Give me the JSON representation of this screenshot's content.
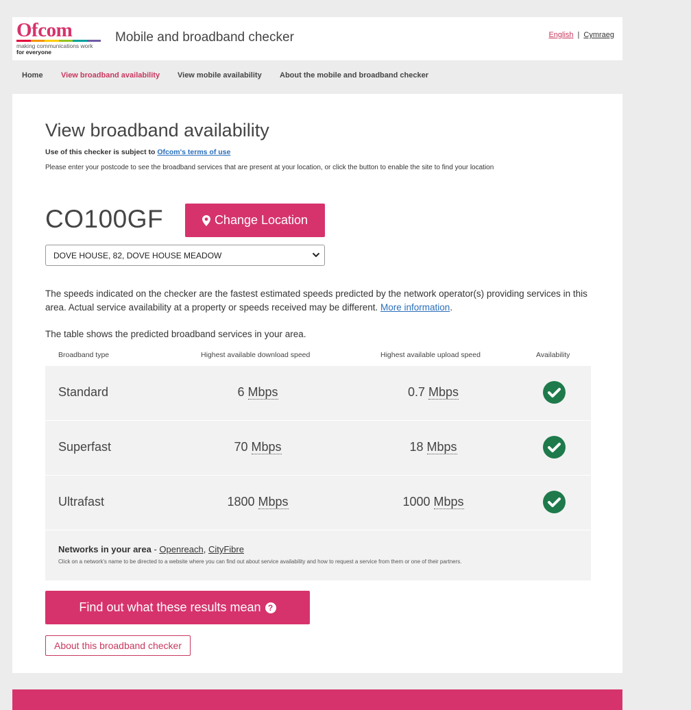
{
  "header": {
    "logo": {
      "wordmark": "Ofcom",
      "tagline": "making communications work",
      "tagline2": "for everyone",
      "stripe_colors": [
        "#e4003b",
        "#f39200",
        "#ffcc00",
        "#95c11f",
        "#00a19a",
        "#6e5ba6"
      ]
    },
    "app_title": "Mobile and broadband checker",
    "lang_english": "English",
    "lang_separator": "|",
    "lang_welsh": "Cymraeg"
  },
  "nav": {
    "items": [
      {
        "label": "Home",
        "active": false
      },
      {
        "label": "View broadband availability",
        "active": true
      },
      {
        "label": "View mobile availability",
        "active": false
      },
      {
        "label": "About the mobile and broadband checker",
        "active": false
      }
    ]
  },
  "main": {
    "title": "View broadband availability",
    "terms_prefix": "Use of this checker is subject to ",
    "terms_link": "Ofcom's terms of use",
    "instructions": "Please enter your postcode to see the broadband services that are present at your location, or click the button to enable the site to find your location",
    "postcode": "CO100GF",
    "change_location_label": "Change Location",
    "address_selected": "DOVE HOUSE, 82, DOVE HOUSE MEADOW",
    "speeds_note": "The speeds indicated on the checker are the fastest estimated speeds predicted by the network operator(s) providing services in this area. Actual service availability at a property or speeds received may be different. ",
    "speeds_note_link": "More information",
    "speeds_note_end": ".",
    "table_intro": "The table shows the predicted broadband services in your area."
  },
  "table": {
    "headers": {
      "type": "Broadband type",
      "download": "Highest available download speed",
      "upload": "Highest available upload speed",
      "availability": "Availability"
    },
    "unit": "Mbps",
    "rows": [
      {
        "type": "Standard",
        "download": "6",
        "upload": "0.7",
        "available": true
      },
      {
        "type": "Superfast",
        "download": "70",
        "upload": "18",
        "available": true
      },
      {
        "type": "Ultrafast",
        "download": "1800",
        "upload": "1000",
        "available": true
      }
    ]
  },
  "networks": {
    "label": "Networks in your area",
    "separator": " - ",
    "links": [
      "Openreach",
      "CityFibre"
    ],
    "link_separator": ", ",
    "note": "Click on a network's name to be directed to a website where you can find out about service availability and how to request a service from them or one of their partners."
  },
  "actions": {
    "results_label": "Find out what these results mean",
    "results_icon": "question-circle-icon",
    "about_label": "About this broadband checker"
  },
  "colors": {
    "brand": "#d6336c",
    "link": "#2a6ebb",
    "check": "#1e7a4b"
  }
}
